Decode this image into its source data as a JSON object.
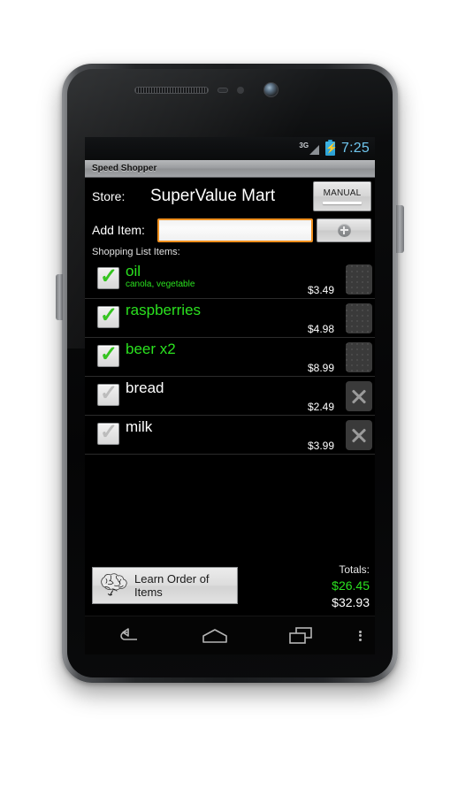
{
  "device": {
    "hardware": {
      "earpiece": "earpiece-speaker",
      "front_camera": "front-camera",
      "power_button": "power-button",
      "volume_button": "volume-button"
    }
  },
  "status_bar": {
    "network": "3G",
    "battery_state": "charging",
    "clock": "7:25",
    "clock_color": "#6fc6ee"
  },
  "app": {
    "title": "Speed Shopper"
  },
  "store_row": {
    "label": "Store:",
    "name": "SuperValue Mart",
    "manual_button": "MANUAL"
  },
  "add_item_row": {
    "label": "Add Item:",
    "value": "",
    "placeholder": "",
    "add_button_icon": "plus-circle-icon"
  },
  "list": {
    "header": "Shopping List Items:",
    "items": [
      {
        "name": "oil",
        "subtitle": "canola, vegetable",
        "price": "$3.49",
        "checked": true,
        "action": "drag-handle"
      },
      {
        "name": "raspberries",
        "subtitle": "",
        "price": "$4.98",
        "checked": true,
        "action": "drag-handle"
      },
      {
        "name": "beer x2",
        "subtitle": "",
        "price": "$8.99",
        "checked": true,
        "action": "drag-handle"
      },
      {
        "name": "bread",
        "subtitle": "",
        "price": "$2.49",
        "checked": false,
        "action": "delete"
      },
      {
        "name": "milk",
        "subtitle": "",
        "price": "$3.99",
        "checked": false,
        "action": "delete"
      }
    ]
  },
  "bottom": {
    "learn_button": "Learn Order of Items",
    "learn_icon": "brain-icon",
    "totals_label": "Totals:",
    "total_checked": "$26.45",
    "total_all": "$32.93"
  },
  "nav_bar": {
    "back": "back-icon",
    "home": "home-icon",
    "recents": "recents-icon",
    "overflow": "overflow-menu-icon"
  },
  "colors": {
    "accent_green": "#2be21f",
    "focus_orange": "#f0901f",
    "clock_blue": "#6fc6ee"
  }
}
